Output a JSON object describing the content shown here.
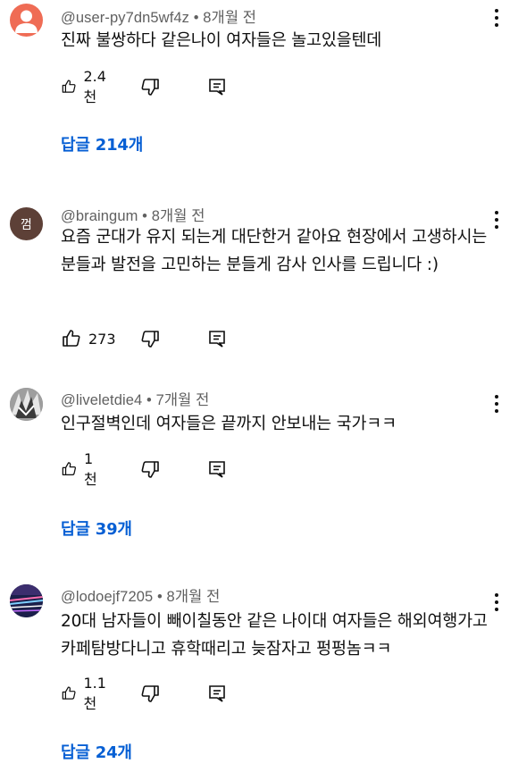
{
  "comments": [
    {
      "handle": "@user-py7dn5wf4z",
      "time": "8개월 전",
      "text": "진짜 불쌍하다 같은나이 여자들은 놀고있을텐데",
      "likes": "2.4천",
      "replies": "답글 214개",
      "avatar_color": "#ef6c55"
    },
    {
      "handle": "@braingum",
      "time": "8개월 전",
      "text": "요즘 군대가 유지 되는게 대단한거 같아요 현장에서 고생하시는분들과 발전을 고민하는 분들게 감사 인사를 드립니다 :)",
      "likes": "273",
      "avatar_text": "껌",
      "avatar_color": "#5d4037"
    },
    {
      "handle": "@liveletdie4",
      "time": "7개월 전",
      "text": "인구절벽인데 여자들은 끝까지 안보내는 국가ㅋㅋ",
      "likes": "1천",
      "replies": "답글 39개"
    },
    {
      "handle": "@lodoejf7205",
      "time": "8개월 전",
      "text": "20대 남자들이 빼이칠동안 같은 나이대 여자들은 해외여행가고 카페탐방다니고 휴학때리고 늦잠자고 펑펑놈ㅋㅋ",
      "likes": "1.1천",
      "replies": "답글 24개"
    }
  ],
  "separator": "•"
}
